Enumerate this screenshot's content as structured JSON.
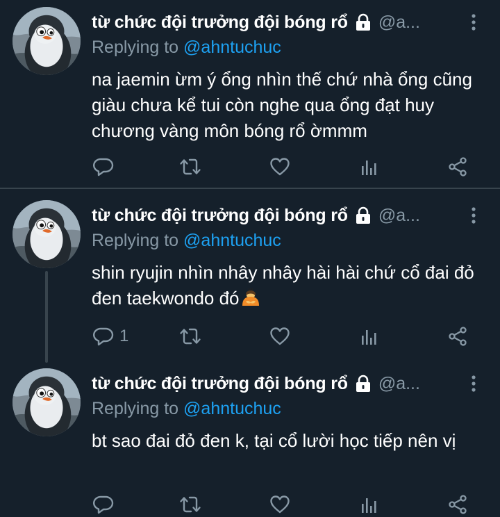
{
  "tweets": [
    {
      "name": "từ chức đội trưởng đội bóng rổ",
      "handle": "@a...",
      "replying_prefix": "Replying to",
      "replying_to": "@ahntuchuc",
      "text": "na jaemin ừm ý ổng nhìn thế chứ nhà ổng cũng giàu chưa kể tui còn nghe qua ổng đạt huy chương vàng môn bóng rổ ờmmm",
      "reply_count": "",
      "icons": [
        "lock-icon",
        "more-icon",
        "reply-icon",
        "retweet-icon",
        "like-icon",
        "analytics-icon",
        "share-icon"
      ]
    },
    {
      "name": "từ chức đội trưởng đội bóng rổ",
      "handle": "@a...",
      "replying_prefix": "Replying to",
      "replying_to": "@ahntuchuc",
      "text": "shin ryujin nhìn nhây nhây hài hài chứ cổ đai đỏ đen taekwondo đó",
      "emoji": "person-bowing-emoji",
      "reply_count": "1",
      "icons": [
        "lock-icon",
        "more-icon",
        "reply-icon",
        "retweet-icon",
        "like-icon",
        "analytics-icon",
        "share-icon"
      ]
    },
    {
      "name": "từ chức đội trưởng đội bóng rổ",
      "handle": "@a...",
      "replying_prefix": "Replying to",
      "replying_to": "@ahntuchuc",
      "text": "bt sao đai đỏ đen k, tại cổ lười học tiếp nên vị",
      "reply_count": "",
      "icons": [
        "lock-icon",
        "more-icon",
        "reply-icon",
        "retweet-icon",
        "like-icon",
        "analytics-icon",
        "share-icon"
      ]
    }
  ],
  "colors": {
    "background": "#15202b",
    "text_primary": "#ffffff",
    "text_secondary": "#8899a6",
    "accent": "#1da1f2",
    "divider": "#38444d"
  }
}
